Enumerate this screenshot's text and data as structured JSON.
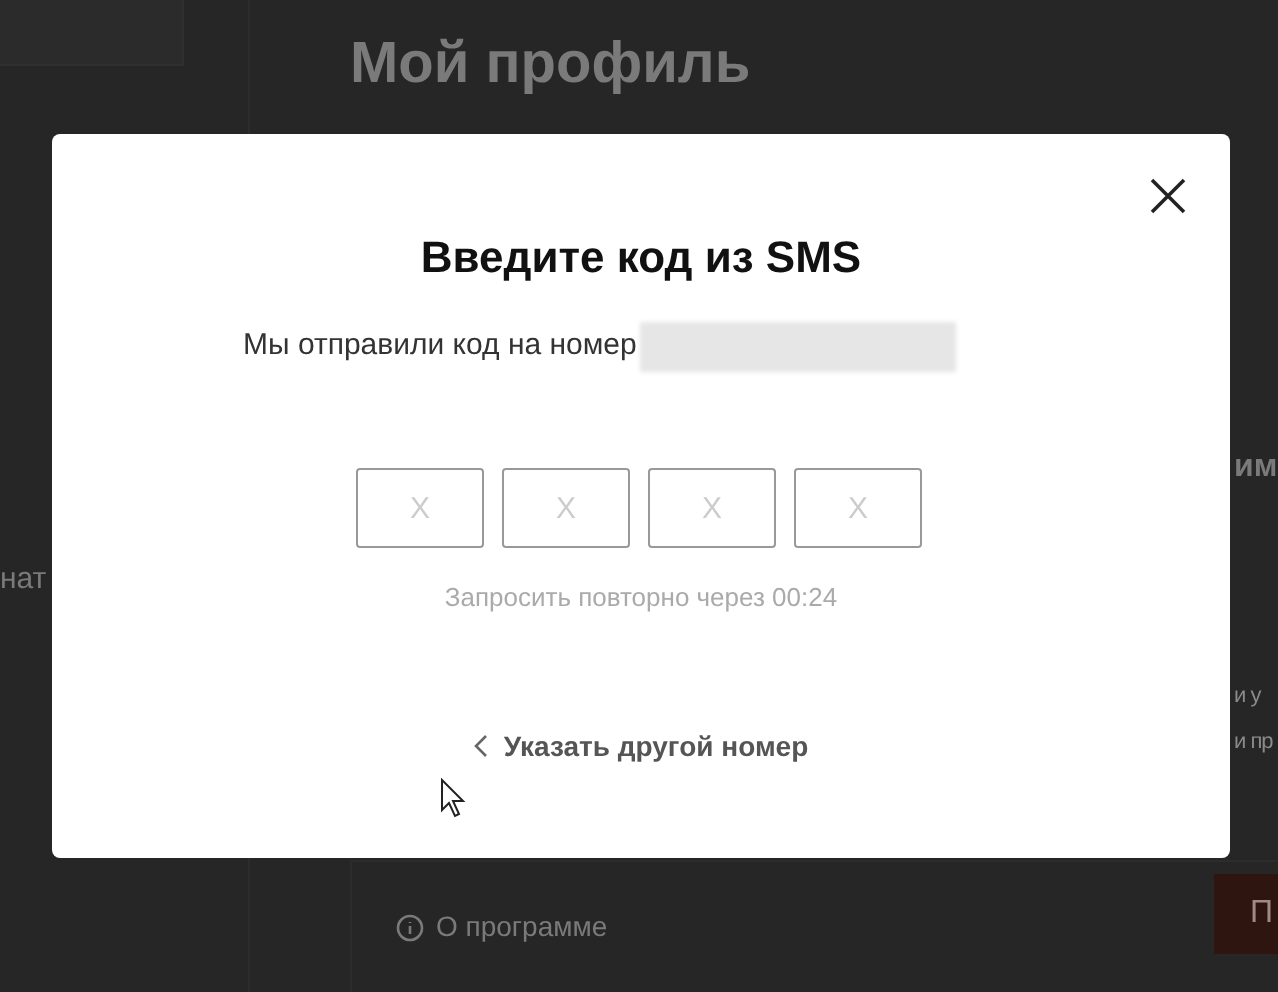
{
  "background": {
    "heading": "Мой профиль",
    "sidebar_fragment": "нат",
    "section_fragment": "им",
    "text_fragments": [
      "и у",
      "и пр"
    ],
    "about_link": "О программе",
    "button_fragment": "П"
  },
  "dialog": {
    "title": "Введите код из SMS",
    "message": "Мы отправили код на номер",
    "code_fields": [
      {
        "placeholder": "X"
      },
      {
        "placeholder": "X"
      },
      {
        "placeholder": "X"
      },
      {
        "placeholder": "X"
      }
    ],
    "resend_note": "Запросить повторно через 00:24",
    "back_link": "Указать другой номер"
  }
}
